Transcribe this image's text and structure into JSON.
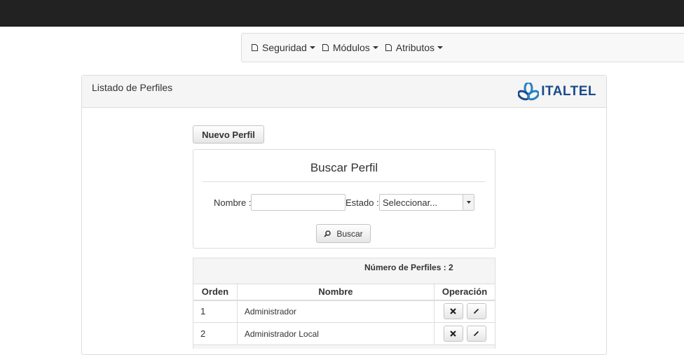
{
  "nav": {
    "items": [
      {
        "label": "Seguridad"
      },
      {
        "label": "Módulos"
      },
      {
        "label": "Atributos"
      }
    ]
  },
  "panel": {
    "title": "Listado de Perfiles",
    "logo_text": "ITALTEL"
  },
  "actions": {
    "nuevo_label": "Nuevo Perfil"
  },
  "search": {
    "title": "Buscar Perfil",
    "nombre_label": "Nombre :",
    "nombre_value": "",
    "estado_label": "Estado :",
    "estado_selected": "Seleccionar...",
    "buscar_label": "Buscar"
  },
  "table": {
    "count_text": "Número de Perfiles : 2",
    "headers": [
      "Orden",
      "Nombre",
      "Operación"
    ],
    "rows": [
      {
        "orden": "1",
        "nombre": "Administrador"
      },
      {
        "orden": "2",
        "nombre": "Administrador Local"
      }
    ]
  },
  "colors": {
    "topbar": "#222222",
    "logo_blue": "#1b4a8a",
    "logo_light_blue": "#2a7fc1"
  }
}
